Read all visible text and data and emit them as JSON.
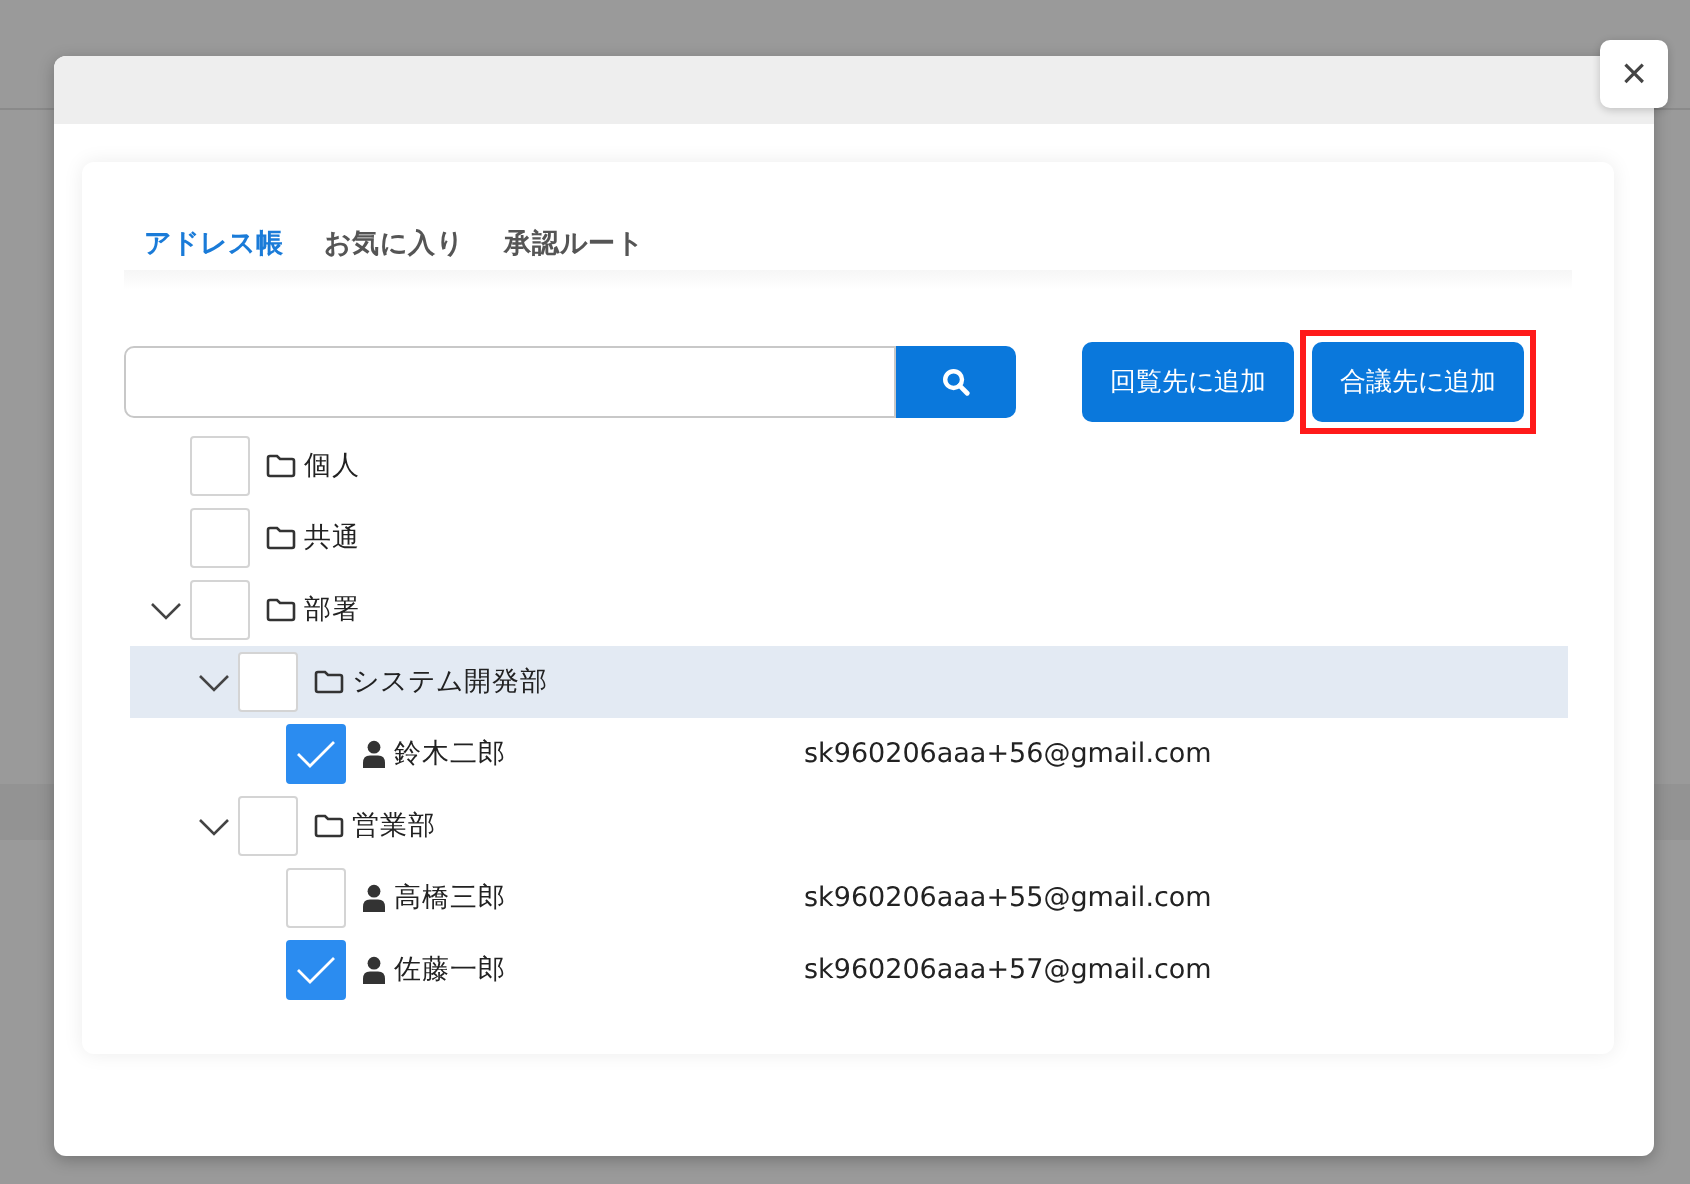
{
  "close_button": {
    "label": "×"
  },
  "tabs": [
    {
      "label": "アドレス帳",
      "selected": true
    },
    {
      "label": "お気に入り",
      "selected": false
    },
    {
      "label": "承認ルート",
      "selected": false
    }
  ],
  "buttons": [
    {
      "label": "回覧先に追加",
      "highlighted": false
    },
    {
      "label": "合議先に追加",
      "highlighted": true
    }
  ],
  "tree": [
    {
      "kind": "folder",
      "name": "個人",
      "checked": false,
      "selected": false
    },
    {
      "kind": "folder",
      "name": "共通",
      "checked": false,
      "selected": false
    },
    {
      "kind": "folder",
      "name": "部署",
      "checked": false,
      "selected": false,
      "expanded": true,
      "children": [
        {
          "kind": "folder",
          "name": "システム開発部",
          "checked": false,
          "selected": true,
          "expanded": true,
          "children": [
            {
              "kind": "person",
              "name": "鈴木二郎",
              "email": "sk960206aaa+56@gmail.com",
              "checked": true,
              "selected": false
            }
          ]
        },
        {
          "kind": "folder",
          "name": "営業部",
          "checked": false,
          "selected": false,
          "expanded": true,
          "children": [
            {
              "kind": "person",
              "name": "高橋三郎",
              "email": "sk960206aaa+55@gmail.com",
              "checked": false,
              "selected": false
            },
            {
              "kind": "person",
              "name": "佐藤一郎",
              "email": "sk960206aaa+57@gmail.com",
              "checked": true,
              "selected": false
            }
          ]
        }
      ]
    }
  ]
}
